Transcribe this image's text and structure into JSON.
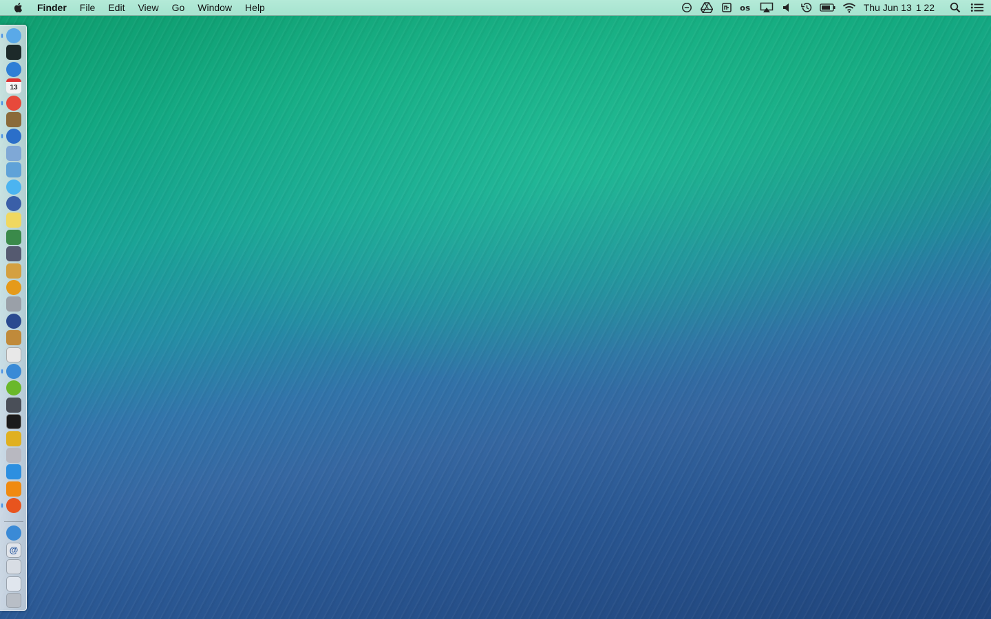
{
  "menubar": {
    "app_name": "Finder",
    "menus": [
      "File",
      "Edit",
      "View",
      "Go",
      "Window",
      "Help"
    ],
    "clock_date": "Thu Jun 13",
    "clock_time": "1 22",
    "status_icons": [
      "do-not-disturb-icon",
      "google-drive-icon",
      "notes-icon",
      "lastpass-icon",
      "airplay-icon",
      "volume-icon",
      "time-machine-icon",
      "battery-icon",
      "wifi-icon"
    ],
    "spotlight_icon": "spotlight-search-icon",
    "notification_icon": "notification-center-icon"
  },
  "dock": {
    "position": "left",
    "items": [
      {
        "name": "finder-icon",
        "color": "#5aa9e8",
        "running": true
      },
      {
        "name": "activity-monitor-icon",
        "color": "#1d2a2a",
        "running": false
      },
      {
        "name": "app-store-icon",
        "color": "#2f7fd6",
        "running": false
      },
      {
        "name": "calendar-icon",
        "color": "#f2f2f2",
        "label": "13",
        "running": false
      },
      {
        "name": "chrome-icon",
        "color": "#e7493b",
        "running": true
      },
      {
        "name": "iphoto-icon",
        "color": "#8a6a3a",
        "running": false
      },
      {
        "name": "itunes-icon",
        "color": "#2b6fc9",
        "running": true
      },
      {
        "name": "preview-icon",
        "color": "#7fa8d6",
        "running": false
      },
      {
        "name": "photo-booth-icon",
        "color": "#5fa2d8",
        "running": false
      },
      {
        "name": "messages-icon",
        "color": "#4bb4f0",
        "running": false
      },
      {
        "name": "quicktime-icon",
        "color": "#3a5fa8",
        "running": false
      },
      {
        "name": "stickies-icon",
        "color": "#f0d860",
        "running": false
      },
      {
        "name": "numbers-icon",
        "color": "#3a8a4a",
        "running": false
      },
      {
        "name": "script-editor-icon",
        "color": "#555a70",
        "running": false
      },
      {
        "name": "pages-icon",
        "color": "#d4a040",
        "running": false
      },
      {
        "name": "plex-icon",
        "color": "#e59a1a",
        "running": false
      },
      {
        "name": "automator-icon",
        "color": "#9aa0a8",
        "running": false
      },
      {
        "name": "quicktime-player-icon",
        "color": "#2a4a90",
        "running": false
      },
      {
        "name": "unarchiver-icon",
        "color": "#c08a3a",
        "running": false
      },
      {
        "name": "textedit-icon",
        "color": "#e8e8e8",
        "running": false
      },
      {
        "name": "safari-icon",
        "color": "#3a8ad6",
        "running": true
      },
      {
        "name": "spotify-icon",
        "color": "#6ab82a",
        "running": false
      },
      {
        "name": "system-preferences-icon",
        "color": "#4a4f58",
        "running": false
      },
      {
        "name": "terminal-icon",
        "color": "#1b1b1b",
        "running": false
      },
      {
        "name": "growl-icon",
        "color": "#e0b020",
        "running": false
      },
      {
        "name": "transmission-icon",
        "color": "#b8b8c0",
        "running": false
      },
      {
        "name": "twitter-icon",
        "color": "#2d8fe0",
        "running": false
      },
      {
        "name": "vlc-icon",
        "color": "#f08a10",
        "running": false
      },
      {
        "name": "firefox-icon",
        "color": "#e8541e",
        "running": true
      }
    ],
    "stack_items": [
      {
        "name": "applications-folder-icon",
        "color": "#3a8ad6"
      },
      {
        "name": "mail-icon",
        "color": "#e0e4ea",
        "label": "@"
      },
      {
        "name": "downloads-folder-icon",
        "color": "#d8dde4"
      },
      {
        "name": "documents-folder-icon",
        "color": "#e0e6ee"
      },
      {
        "name": "trash-icon",
        "color": "#b8bec6"
      }
    ]
  }
}
